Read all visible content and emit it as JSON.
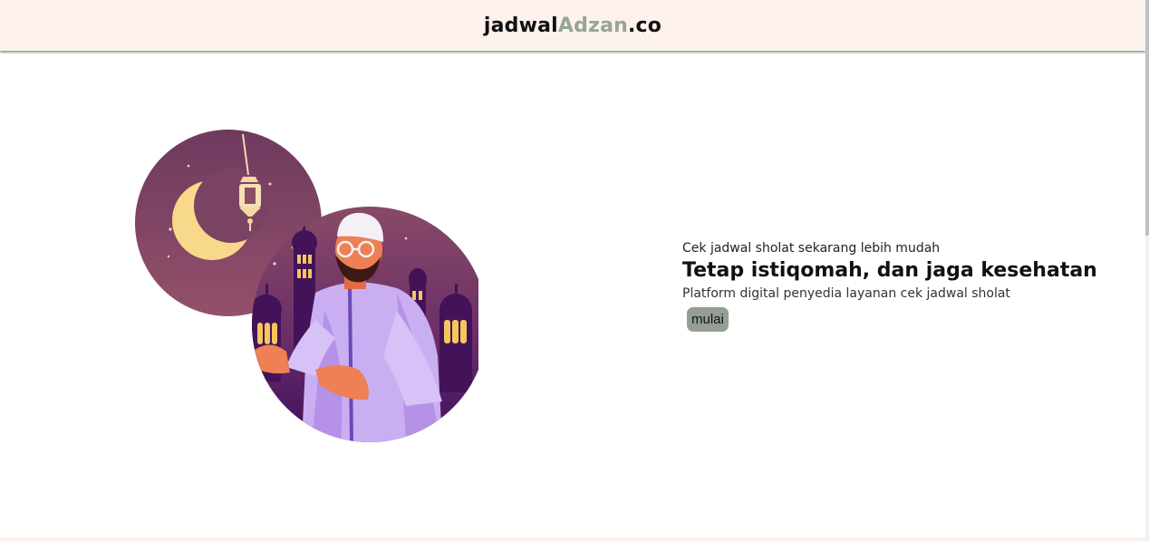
{
  "header": {
    "logo_part1": "jadwal",
    "logo_part2": "Adzan",
    "logo_part3": ".co"
  },
  "hero": {
    "tagline": "Cek jadwal sholat sekarang lebih mudah",
    "headline": "Tetap istiqomah, dan jaga kesehatan",
    "subtitle": "Platform digital penyedia layanan cek jadwal sholat",
    "button_label": "mulai"
  },
  "colors": {
    "header_bg": "#fdf2ec",
    "logo_accent": "#96a596",
    "button_bg": "#939f93"
  }
}
